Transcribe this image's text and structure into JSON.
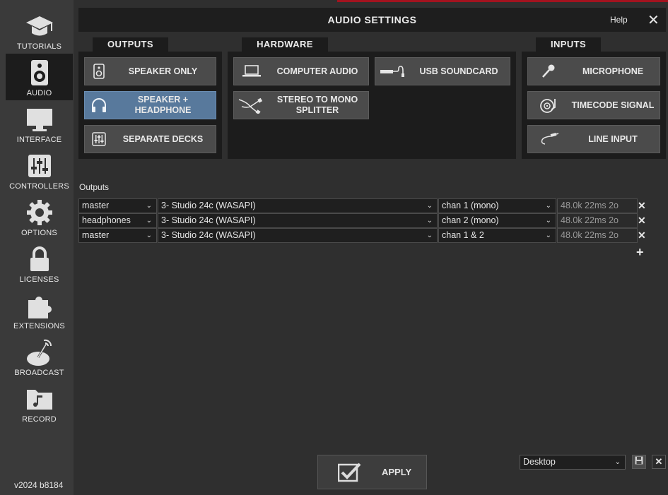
{
  "sidebar": {
    "items": [
      {
        "label": "TUTORIALS",
        "icon": "graduation-cap-icon"
      },
      {
        "label": "AUDIO",
        "icon": "speaker-icon",
        "active": true
      },
      {
        "label": "INTERFACE",
        "icon": "monitor-icon"
      },
      {
        "label": "CONTROLLERS",
        "icon": "sliders-icon"
      },
      {
        "label": "OPTIONS",
        "icon": "gear-icon"
      },
      {
        "label": "LICENSES",
        "icon": "lock-icon"
      },
      {
        "label": "EXTENSIONS",
        "icon": "puzzle-icon"
      },
      {
        "label": "BROADCAST",
        "icon": "satellite-dish-icon"
      },
      {
        "label": "RECORD",
        "icon": "music-folder-icon"
      }
    ],
    "version": "v2024 b8184"
  },
  "header": {
    "title": "AUDIO SETTINGS",
    "help": "Help",
    "close": "✕"
  },
  "groups": {
    "outputs": {
      "tab": "OUTPUTS",
      "buttons": [
        {
          "label": "SPEAKER ONLY",
          "icon": "speaker-icon"
        },
        {
          "label": "SPEAKER + HEADPHONE",
          "icon": "headphones-icon",
          "selected": true
        },
        {
          "label": "SEPARATE DECKS",
          "icon": "mixer-icon"
        }
      ]
    },
    "hardware": {
      "tab": "HARDWARE",
      "buttons": [
        {
          "label": "COMPUTER AUDIO",
          "icon": "laptop-icon"
        },
        {
          "label": "USB SOUNDCARD",
          "icon": "usb-soundcard-icon"
        },
        {
          "label": "STEREO TO MONO SPLITTER",
          "icon": "splitter-cable-icon"
        }
      ]
    },
    "inputs": {
      "tab": "INPUTS",
      "buttons": [
        {
          "label": "MICROPHONE",
          "icon": "microphone-icon"
        },
        {
          "label": "TIMECODE SIGNAL",
          "icon": "turntable-icon"
        },
        {
          "label": "LINE INPUT",
          "icon": "cable-icon"
        }
      ]
    }
  },
  "outputs_table": {
    "label": "Outputs",
    "rows": [
      {
        "role": "master",
        "device": "3- Studio 24c (WASAPI)",
        "channel": "chan 1 (mono)",
        "info": "48.0k 22ms 2o"
      },
      {
        "role": "headphones",
        "device": "3- Studio 24c (WASAPI)",
        "channel": "chan 2 (mono)",
        "info": "48.0k 22ms 2o"
      },
      {
        "role": "master",
        "device": "3- Studio 24c (WASAPI)",
        "channel": "chan 1 & 2",
        "info": "48.0k 22ms 2o"
      }
    ],
    "remove": "✕",
    "add": "+"
  },
  "footer": {
    "apply": "APPLY",
    "preset": "Desktop",
    "delete": "✕"
  },
  "colors": {
    "selected": "#58799c",
    "accent_red": "#a3131f",
    "panel": "#1c1c1c"
  }
}
